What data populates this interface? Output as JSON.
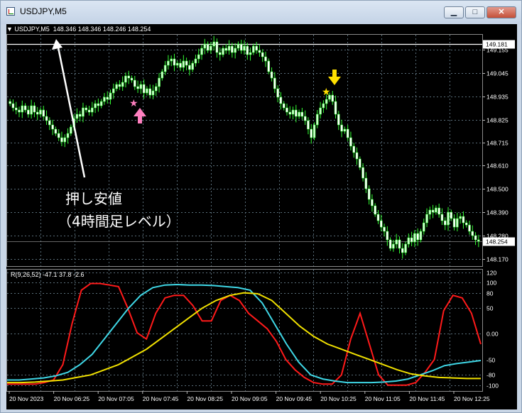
{
  "window": {
    "title": "USDJPY,M5",
    "buttons": {
      "minimize": "▁",
      "maximize": "□",
      "close": "✕"
    }
  },
  "price_pane": {
    "header": "USDJPY,M5  148.346 148.346 148.246 148.254",
    "price_ticks": [
      149.155,
      149.045,
      148.935,
      148.825,
      148.715,
      148.61,
      148.5,
      148.39,
      148.28,
      148.17
    ],
    "price_tick_labels": [
      "149.155",
      "149.045",
      "148.935",
      "148.825",
      "148.715",
      "148.610",
      "148.500",
      "148.390",
      "148.280",
      "148.170"
    ],
    "level_price": 149.181,
    "level_label": "149.181",
    "current_price": 148.254,
    "current_label": "148.254",
    "annotation_line1": "押し安値",
    "annotation_line2": "（4時間足レベル）"
  },
  "indicator_pane": {
    "header": "R(9,26,52) -47.1 37.8 -2.6",
    "tick_labels": [
      "120",
      "100",
      "80",
      "50",
      "0.00",
      "-50",
      "-80",
      "-100"
    ],
    "tick_values": [
      120,
      100,
      80,
      50,
      0,
      -50,
      -80,
      -100
    ]
  },
  "time_axis": {
    "labels": [
      "20 Nov 2023",
      "20 Nov 06:25",
      "20 Nov 07:05",
      "20 Nov 07:45",
      "20 Nov 08:25",
      "20 Nov 09:05",
      "20 Nov 09:45",
      "20 Nov 10:25",
      "20 Nov 11:05",
      "20 Nov 11:45",
      "20 Nov 12:25"
    ]
  },
  "colors": {
    "background": "#000000",
    "grid": "#5a6e7a",
    "bull_candle": "#ccffcc",
    "bear_candle": "#ffffff",
    "wick": "#33ff33",
    "red_line": "#ff1a1a",
    "cyan_line": "#3fd7e6",
    "yellow_line": "#f0e000",
    "buy_marker": "#ff7fbf",
    "sell_marker": "#ffe000"
  },
  "markers": {
    "buy_arrow_icon": "pink-up-arrow-icon",
    "buy_star_icon": "pink-star-icon",
    "sell_arrow_icon": "yellow-down-arrow-icon",
    "sell_star_icon": "yellow-star-icon"
  },
  "chart_data": {
    "type": "candlestick",
    "symbol": "USDJPY",
    "timeframe": "M5",
    "y_range": [
      148.14,
      149.21
    ],
    "closes": [
      148.9,
      148.88,
      148.87,
      148.86,
      148.89,
      148.87,
      148.85,
      148.89,
      148.86,
      148.85,
      148.87,
      148.84,
      148.82,
      148.8,
      148.78,
      148.76,
      148.74,
      148.72,
      148.74,
      148.76,
      148.79,
      148.83,
      148.85,
      148.84,
      148.88,
      148.87,
      148.86,
      148.88,
      148.9,
      148.89,
      148.91,
      148.93,
      148.92,
      148.95,
      148.97,
      148.99,
      148.98,
      149.0,
      149.03,
      149.02,
      149.01,
      148.98,
      148.97,
      148.99,
      148.95,
      148.97,
      148.94,
      148.96,
      148.98,
      149.02,
      149.05,
      149.08,
      149.1,
      149.11,
      149.08,
      149.09,
      149.07,
      149.1,
      149.08,
      149.06,
      149.09,
      149.11,
      149.13,
      149.16,
      149.18,
      149.15,
      149.17,
      149.19,
      149.14,
      149.13,
      149.16,
      149.15,
      149.17,
      149.14,
      149.16,
      149.18,
      149.15,
      149.17,
      149.13,
      149.14,
      149.17,
      149.15,
      149.14,
      149.12,
      149.1,
      149.05,
      149.02,
      148.97,
      148.93,
      148.9,
      148.88,
      148.86,
      148.85,
      148.87,
      148.84,
      148.86,
      148.84,
      148.82,
      148.78,
      148.74,
      148.8,
      148.85,
      148.88,
      148.9,
      148.92,
      148.94,
      148.91,
      148.85,
      148.8,
      148.77,
      148.78,
      148.74,
      148.7,
      148.67,
      148.64,
      148.6,
      148.55,
      148.5,
      148.45,
      148.42,
      148.38,
      148.35,
      148.32,
      148.3,
      148.26,
      148.22,
      148.24,
      148.26,
      148.22,
      148.2,
      148.24,
      148.27,
      148.25,
      148.29,
      148.26,
      148.3,
      148.34,
      148.38,
      148.4,
      148.39,
      148.41,
      148.38,
      148.35,
      148.33,
      148.39,
      148.36,
      148.32,
      148.36,
      148.37,
      148.34,
      148.33,
      148.3,
      148.28,
      148.26,
      148.254
    ],
    "level": 149.181,
    "indicator": {
      "name": "R(9,26,52)",
      "y_range": [
        -110,
        125
      ],
      "series": [
        {
          "name": "R(9)",
          "values": [
            -98,
            -98,
            -98,
            -98,
            -95,
            -90,
            -60,
            20,
            85,
            98,
            98,
            95,
            92,
            50,
            2,
            -10,
            40,
            70,
            75,
            75,
            55,
            25,
            25,
            65,
            75,
            65,
            40,
            25,
            10,
            -15,
            -50,
            -70,
            -85,
            -95,
            -98,
            -98,
            -80,
            -10,
            40,
            -20,
            -80,
            -100,
            -100,
            -100,
            -95,
            -75,
            -50,
            45,
            75,
            70,
            40,
            -20
          ]
        },
        {
          "name": "R(26)",
          "values": [
            -90,
            -90,
            -88,
            -86,
            -82,
            -75,
            -60,
            -40,
            -10,
            20,
            50,
            75,
            90,
            95,
            96,
            95,
            95,
            94,
            92,
            90,
            85,
            60,
            20,
            -20,
            -55,
            -80,
            -88,
            -92,
            -95,
            -95,
            -95,
            -94,
            -92,
            -88,
            -80,
            -72,
            -62,
            -58,
            -55,
            -52
          ]
        },
        {
          "name": "R(52)",
          "values": [
            -95,
            -95,
            -94,
            -92,
            -90,
            -85,
            -80,
            -70,
            -60,
            -45,
            -30,
            -10,
            10,
            30,
            50,
            65,
            75,
            80,
            78,
            65,
            40,
            15,
            -5,
            -20,
            -30,
            -40,
            -50,
            -60,
            -70,
            -78,
            -82,
            -85,
            -86,
            -87,
            -87
          ]
        }
      ]
    }
  }
}
